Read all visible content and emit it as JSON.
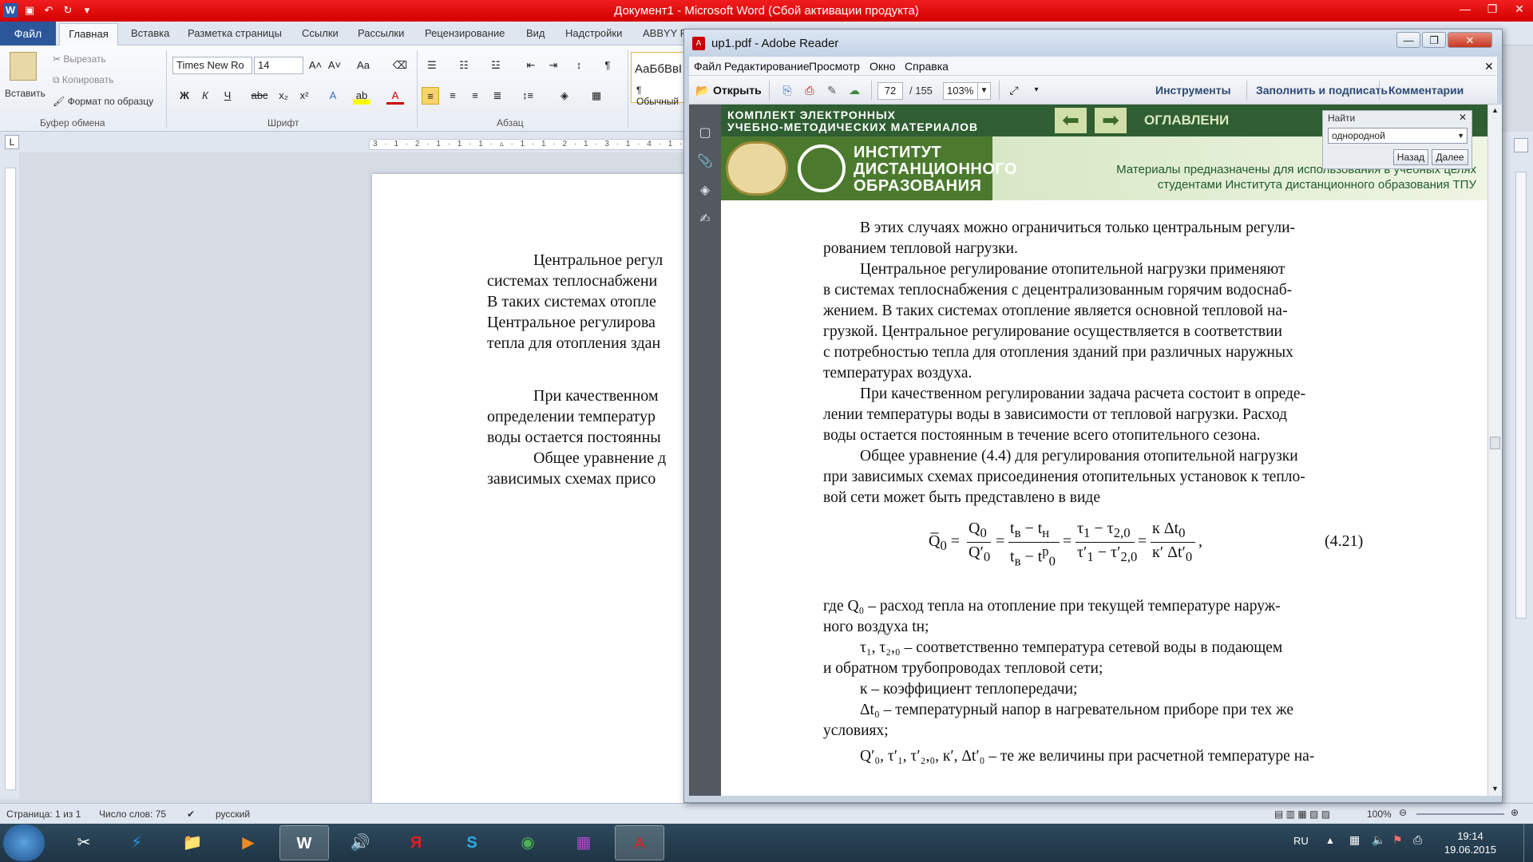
{
  "word": {
    "title": "Документ1 - Microsoft Word (Сбой активации продукта)",
    "tabs": [
      "Файл",
      "Главная",
      "Вставка",
      "Разметка страницы",
      "Ссылки",
      "Рассылки",
      "Рецензирование",
      "Вид",
      "Надстройки",
      "ABBYY Fi"
    ],
    "clipboard": {
      "paste": "Вставить",
      "cut": "Вырезать",
      "copy": "Копировать",
      "format": "Формат по образцу",
      "label": "Буфер обмена"
    },
    "font": {
      "name": "Times New Ro",
      "size": "14",
      "label": "Шрифт"
    },
    "paragraph_label": "Абзац",
    "styles_preview": "АаБбВвI",
    "styles_name": "¶ Обычный",
    "ruler": "3 · 1 · 2 · 1 · 1 · 1 · ▵ · 1 · 1 · 2 · 1 · 3 · 1 · 4 · 1 · 5",
    "page_lines": [
      "Центральное регул",
      "системах теплоснабжени",
      "В таких системах отопле",
      "Центральное регулирова",
      "тепла для отопления здан",
      "При качественном",
      "определении температур",
      "воды остается постоянны",
      "Общее уравнение д",
      "зависимых схемах присо"
    ],
    "status": {
      "page": "Страница: 1 из 1",
      "words": "Число слов: 75",
      "lang": "русский",
      "zoom": "100%"
    }
  },
  "pdf": {
    "title": "up1.pdf - Adobe Reader",
    "menu": [
      "Файл",
      "Редактирование",
      "Просмотр",
      "Окно",
      "Справка"
    ],
    "toolbar": {
      "open": "Открыть",
      "page": "72",
      "pages": "/ 155",
      "zoom": "103%",
      "tools": "Инструменты",
      "fill": "Заполнить и подписать",
      "comments": "Комментарии"
    },
    "banner": {
      "line1": "КОМПЛЕКТ ЭЛЕКТРОННЫХ",
      "line2": "УЧЕБНО-МЕТОДИЧЕСКИХ МАТЕРИАЛОВ",
      "toc": "ОГЛАВЛЕНИ",
      "inst1": "ИНСТИТУТ",
      "inst2": "ДИСТАНЦИОННОГО",
      "inst3": "ОБРАЗОВАНИЯ",
      "note1": "Материалы предназначены для использования в учебных целях",
      "note2": "студентами Института дистанционного образования ТПУ"
    },
    "find": {
      "title": "Найти",
      "value": "однородной",
      "back": "Назад",
      "next": "Далее"
    },
    "text": [
      "В этих случаях можно ограничиться только центральным регули-",
      "рованием тепловой нагрузки.",
      "Центральное регулирование отопительной нагрузки применяют",
      "в системах теплоснабжения с децентрализованным горячим водоснаб-",
      "жением. В таких системах отопление является основной тепловой на-",
      "грузкой. Центральное регулирование осуществляется в соответствии",
      "с потребностью тепла для отопления зданий при различных наружных",
      "температурах воздуха.",
      "При качественном регулировании задача расчета состоит в опреде-",
      "лении температуры воды в зависимости от тепловой нагрузки. Расход",
      "воды остается постоянным в течение всего отопительного сезона.",
      "Общее уравнение (4.4) для регулирования отопительной нагрузки",
      "при зависимых схемах присоединения отопительных установок к тепло-",
      "вой сети может быть представлено в виде"
    ],
    "eq_number": "(4.21)",
    "defs": [
      "где   Q₀ – расход тепла на отопление при текущей температуре наруж-",
      "ного воздуха tн;",
      "τ₁, τ₂,₀ – соответственно температура сетевой воды в подающем",
      "и обратном трубопроводах тепловой сети;",
      "к – коэффициент теплопередачи;",
      "Δt₀ – температурный напор в нагревательном приборе при тех же",
      "условиях;",
      "Q′₀, τ′₁, τ′₂,₀, к′, Δt′₀ – те же величины при расчетной температуре на-"
    ]
  },
  "taskbar": {
    "lang": "RU",
    "time": "19:14",
    "date": "19.06.2015"
  }
}
